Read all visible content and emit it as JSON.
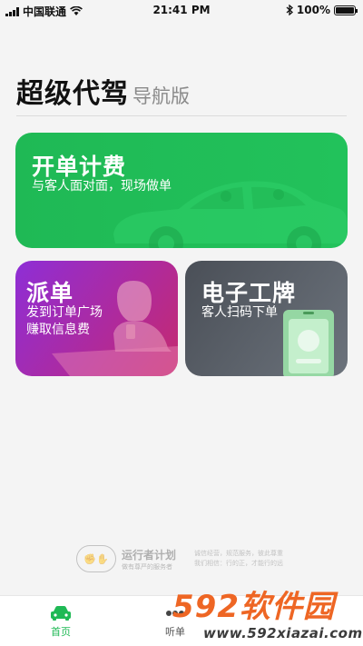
{
  "status_bar": {
    "carrier": "中国联通",
    "time": "21:41 PM",
    "battery": "100%",
    "battery_level": 1.0
  },
  "header": {
    "title": "超级代驾",
    "subtitle": "导航版"
  },
  "cards": [
    {
      "title": "开单计费",
      "subtitle": "与客人面对面，现场做单",
      "icon": "car-illustration"
    },
    {
      "title": "派单",
      "subtitle_lines": [
        "发到订单广场",
        "赚取信息费"
      ],
      "icon": "woman-phone-illustration"
    },
    {
      "title": "电子工牌",
      "subtitle": "客人扫码下单",
      "icon": "id-badge-illustration"
    }
  ],
  "footer": {
    "logo_text": "运行者计划",
    "logo_sub": "做有尊严的服务者",
    "motto_line1": "诚信经营，规范服务，彼此尊重",
    "motto_line2": "我们相信：行的正，才能行的远"
  },
  "tabbar": {
    "tabs": [
      {
        "label": "首页",
        "icon": "car-icon",
        "active": true
      },
      {
        "label": "听单",
        "icon": "dots-icon",
        "active": false
      }
    ]
  },
  "watermark": {
    "brand": "592软件园",
    "url": "www.592xiazai.com"
  },
  "colors": {
    "accent_green": "#1fb955",
    "dispatch_purple": "#9b2fc7",
    "badge_gray": "#555b63",
    "watermark_orange": "#ee6624"
  }
}
